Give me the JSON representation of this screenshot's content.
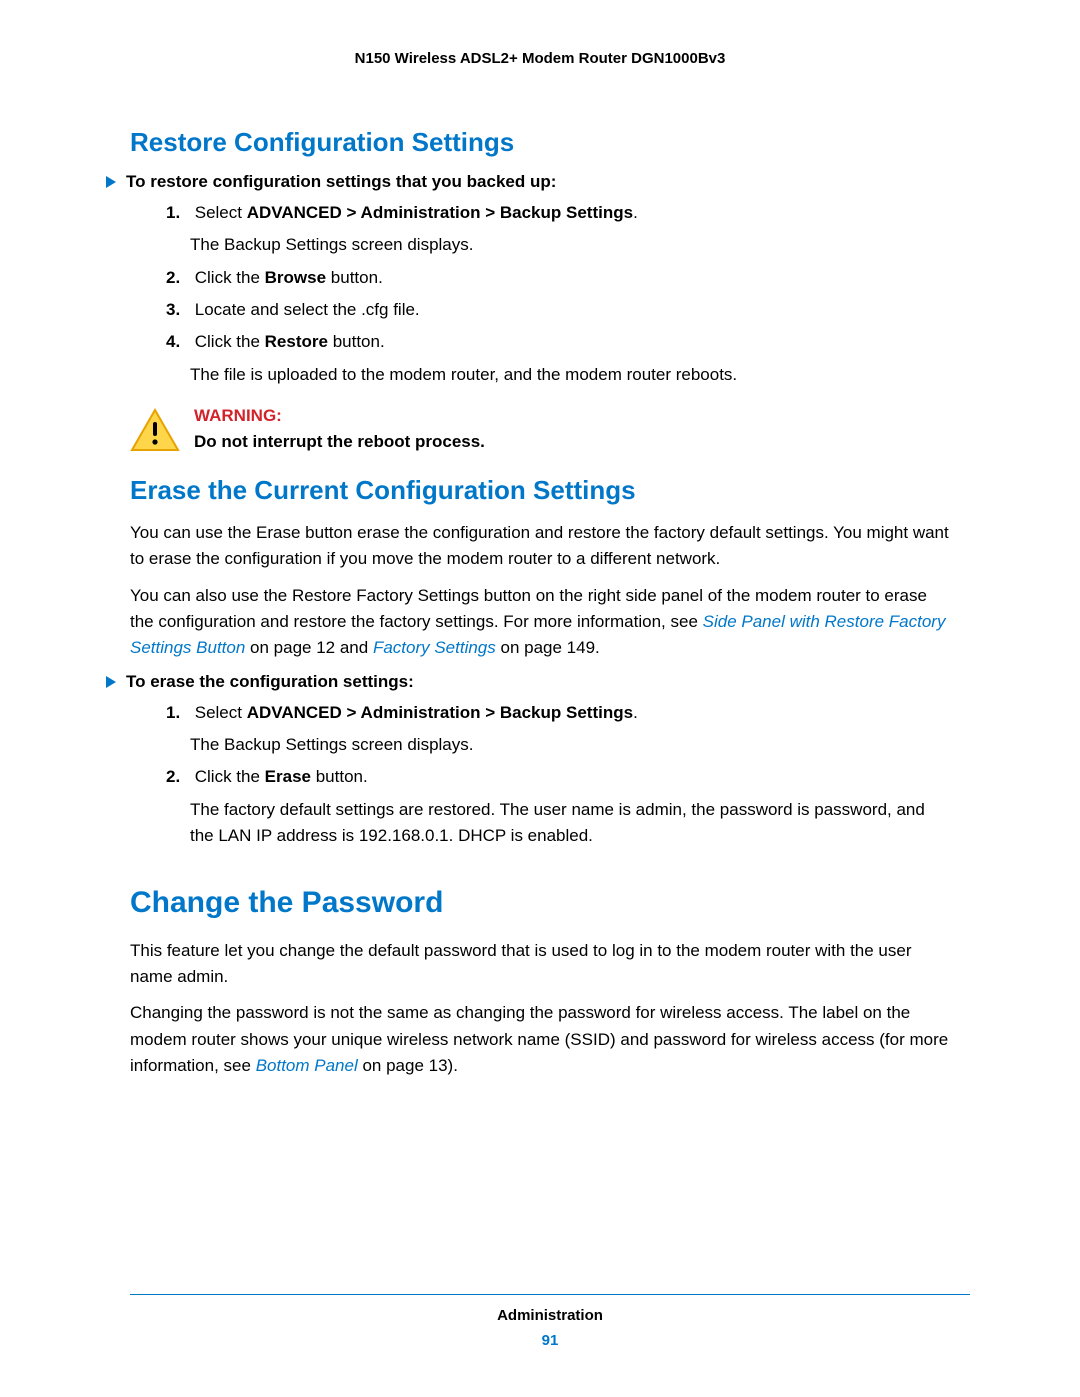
{
  "header": {
    "title": "N150 Wireless ADSL2+ Modem Router DGN1000Bv3"
  },
  "section1": {
    "heading": "Restore Configuration Settings",
    "lead": "To restore configuration settings that you backed up:",
    "steps": {
      "s1_num": "1.",
      "s1_pre": "Select ",
      "s1_bold": "ADVANCED > Administration > Backup Settings",
      "s1_post": ".",
      "s1_sub": "The Backup Settings screen displays.",
      "s2_num": "2.",
      "s2_pre": "Click the ",
      "s2_bold": "Browse",
      "s2_post": " button.",
      "s3_num": "3.",
      "s3_text": "Locate and select the .cfg file.",
      "s4_num": "4.",
      "s4_pre": "Click the ",
      "s4_bold": "Restore",
      "s4_post": " button.",
      "s4_sub": "The file is uploaded to the modem router, and the modem router reboots."
    },
    "warning": {
      "label": "WARNING:",
      "text": "Do not interrupt the reboot process."
    }
  },
  "section2": {
    "heading": "Erase the Current Configuration Settings",
    "para1": "You can use the Erase button erase the configuration and restore the factory default settings. You might want to erase the configuration if you move the modem router to a different network.",
    "para2_pre": "You can also use the Restore Factory Settings button on the right side panel of the modem router to erase the configuration and restore the factory settings. For more information, see ",
    "para2_link1": "Side Panel with Restore Factory Settings Button",
    "para2_mid": " on page 12 and ",
    "para2_link2": "Factory Settings",
    "para2_post": " on page 149.",
    "lead": "To erase the configuration settings:",
    "steps": {
      "s1_num": "1.",
      "s1_pre": "Select ",
      "s1_bold": "ADVANCED > Administration > Backup Settings",
      "s1_post": ".",
      "s1_sub": "The Backup Settings screen displays.",
      "s2_num": "2.",
      "s2_pre": "Click the ",
      "s2_bold": "Erase",
      "s2_post": " button.",
      "s2_sub": "The factory default settings are restored. The user name is admin, the password is password, and the LAN IP address is 192.168.0.1. DHCP is enabled."
    }
  },
  "section3": {
    "heading": "Change the Password",
    "para1": "This feature let you change the default password that is used to log in to the modem router with the user name admin.",
    "para2_pre": "Changing the password is not the same as changing the password for wireless access. The label on the modem router shows your unique wireless network name (SSID) and password for wireless access (for more information, see ",
    "para2_link": "Bottom Panel",
    "para2_post": " on page 13)."
  },
  "footer": {
    "section": "Administration",
    "page": "91"
  }
}
